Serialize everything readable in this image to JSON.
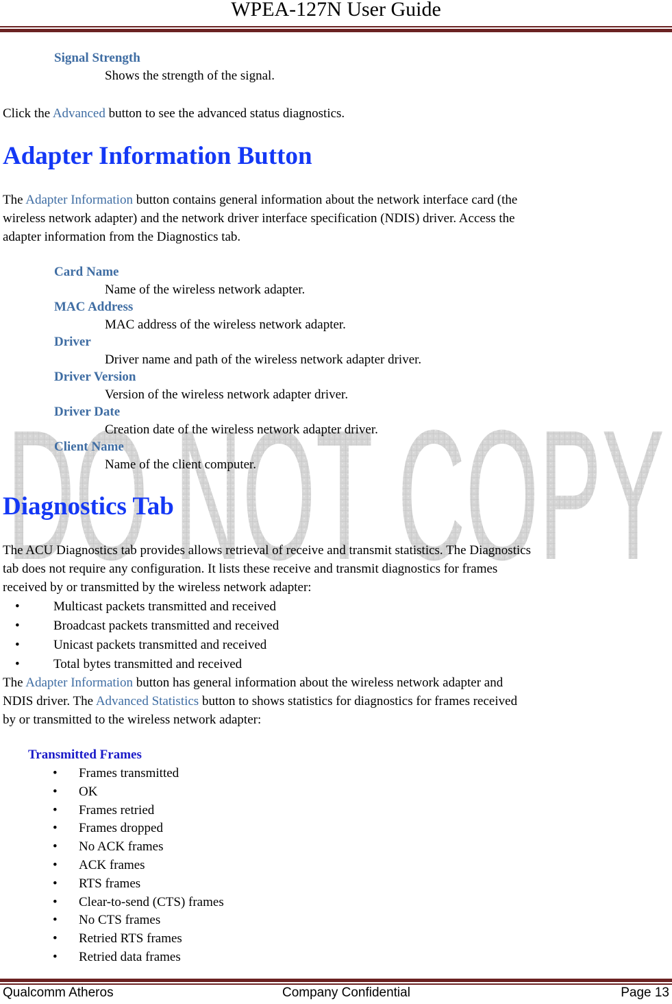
{
  "header": {
    "title": "WPEA-127N User Guide"
  },
  "watermark": {
    "text": "DO NOT COPY"
  },
  "signal_section": {
    "term": "Signal Strength",
    "definition": "Shows the strength of the signal.",
    "advanced_text_pre": "Click the ",
    "advanced_link": "Advanced",
    "advanced_text_post": " button to see the advanced status diagnostics."
  },
  "adapter_section": {
    "heading": "Adapter Information Button",
    "intro_pre": "The ",
    "intro_link": "Adapter Information",
    "intro_line1_post": " button contains general information about the network interface card (the",
    "intro_line2": "wireless network adapter) and the network driver interface specification (NDIS) driver. Access the",
    "intro_line3": "adapter information from the Diagnostics tab.",
    "items": [
      {
        "term": "Card Name",
        "definition": "Name of the wireless network adapter."
      },
      {
        "term": "MAC Address",
        "definition": "MAC address of the wireless network adapter."
      },
      {
        "term": "Driver",
        "definition": "Driver name and path of the wireless network adapter driver."
      },
      {
        "term": "Driver Version",
        "definition": "Version of the wireless network adapter driver."
      },
      {
        "term": "Driver Date",
        "definition": "Creation date of the wireless network adapter driver."
      },
      {
        "term": "Client Name",
        "definition": "Name of the client computer."
      }
    ]
  },
  "diagnostics_section": {
    "heading": "Diagnostics Tab",
    "intro_line1": "The ACU Diagnostics tab provides allows retrieval of receive and transmit statistics. The Diagnostics",
    "intro_line2": "tab does not require any configuration. It lists these receive and transmit diagnostics for frames",
    "intro_line3": "received by or transmitted by the wireless network adapter:",
    "bullets": [
      "Multicast packets transmitted and received",
      "Broadcast packets transmitted and received",
      "Unicast packets transmitted and received",
      "Total bytes transmitted and received"
    ],
    "after_pre": "The ",
    "after_link1": "Adapter Information",
    "after_line1_post": " button has general information about the wireless network adapter and",
    "after_line2_pre": "NDIS driver. The ",
    "after_link2": "Advanced Statistics",
    "after_line2_post": " button to shows statistics for diagnostics for frames received",
    "after_line3": "by or transmitted to the wireless network adapter:",
    "transmitted_heading": "Transmitted Frames",
    "transmitted_items": [
      "Frames transmitted",
      "OK",
      "Frames retried",
      "Frames dropped",
      "No ACK frames",
      "ACK frames",
      "RTS frames",
      "Clear-to-send (CTS) frames",
      "No CTS frames",
      "Retried RTS frames",
      "Retried data frames"
    ],
    "bullet_glyph": "•"
  },
  "footer": {
    "company": "Qualcomm Atheros",
    "confidential": "Company Confidential",
    "page": "Page 13"
  }
}
